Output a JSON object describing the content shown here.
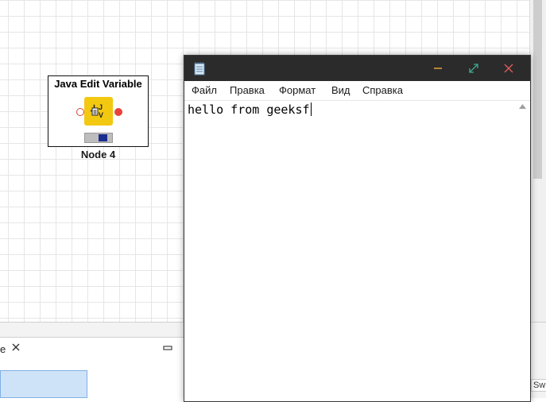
{
  "canvas": {
    "node": {
      "title": "Java Edit Variable",
      "label": "Node 4",
      "icon": "java-edit-variable-icon"
    }
  },
  "bottom_panel": {
    "tab_label": "e",
    "close_icon": "close-icon",
    "minimize_icon": "minimize-icon",
    "right_label": "Sw"
  },
  "notepad": {
    "icon": "notepad-icon",
    "menu": [
      "Файл",
      "Правка",
      "Формат",
      "Вид",
      "Справка"
    ],
    "content": "hello from geeksf",
    "buttons": {
      "minimize_icon": "minimize-icon",
      "maximize_icon": "maximize-icon",
      "close_icon": "close-icon"
    }
  },
  "colors": {
    "titlebar": "#2b2b2b",
    "node_icon": "#f2c811",
    "port": "#e8423a",
    "minimize_glyph": "#e8a33d",
    "maximize_glyph": "#3fa98f",
    "close_glyph": "#e05a5a"
  }
}
